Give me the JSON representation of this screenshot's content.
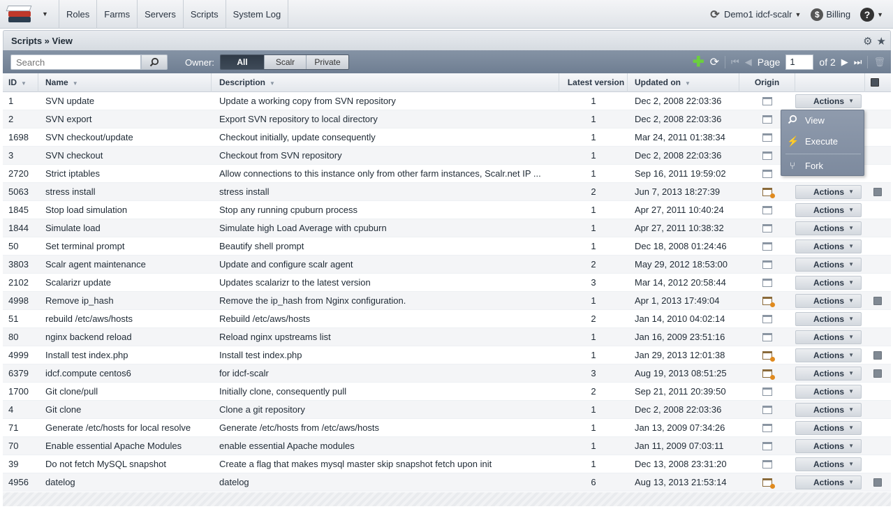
{
  "topbar": {
    "nav": [
      "Roles",
      "Farms",
      "Servers",
      "Scripts",
      "System Log"
    ],
    "environment": "Demo1 idcf-scalr",
    "billing": "Billing",
    "help": "?"
  },
  "panel": {
    "title": "Scripts » View"
  },
  "toolbar": {
    "search_placeholder": "Search",
    "owner_label": "Owner:",
    "owner_options": [
      "All",
      "Scalr",
      "Private"
    ],
    "owner_selected": "All",
    "page_label": "Page",
    "page_value": "1",
    "page_of": "of 2"
  },
  "grid": {
    "columns": {
      "id": "ID",
      "name": "Name",
      "description": "Description",
      "latest_version": "Latest version",
      "updated_on": "Updated on",
      "origin": "Origin"
    },
    "rows": [
      {
        "id": "1",
        "name": "SVN update",
        "description": "Update a working copy from SVN repository",
        "version": "1",
        "updated": "Dec 2, 2008 22:03:36",
        "origin": "shared",
        "action": "Actions",
        "checkbox": false
      },
      {
        "id": "2",
        "name": "SVN export",
        "description": "Export SVN repository to local directory",
        "version": "1",
        "updated": "Dec 2, 2008 22:03:36",
        "origin": "shared",
        "action": "",
        "checkbox": false
      },
      {
        "id": "1698",
        "name": "SVN checkout/update",
        "description": "Checkout initially, update consequently",
        "version": "1",
        "updated": "Mar 24, 2011 01:38:34",
        "origin": "shared",
        "action": "",
        "checkbox": false
      },
      {
        "id": "3",
        "name": "SVN checkout",
        "description": "Checkout from SVN repository",
        "version": "1",
        "updated": "Dec 2, 2008 22:03:36",
        "origin": "shared",
        "action": "",
        "checkbox": false
      },
      {
        "id": "2720",
        "name": "Strict iptables",
        "description": "Allow connections to this instance only from other farm instances, Scalr.net IP ...",
        "version": "1",
        "updated": "Sep 16, 2011 19:59:02",
        "origin": "shared",
        "action": "",
        "checkbox": false
      },
      {
        "id": "5063",
        "name": "stress install",
        "description": "stress install",
        "version": "2",
        "updated": "Jun 7, 2013 18:27:39",
        "origin": "custom",
        "action": "Actions",
        "checkbox": true
      },
      {
        "id": "1845",
        "name": "Stop load simulation",
        "description": "Stop any running cpuburn process",
        "version": "1",
        "updated": "Apr 27, 2011 10:40:24",
        "origin": "shared",
        "action": "Actions",
        "checkbox": false
      },
      {
        "id": "1844",
        "name": "Simulate load",
        "description": "Simulate high Load Average with cpuburn",
        "version": "1",
        "updated": "Apr 27, 2011 10:38:32",
        "origin": "shared",
        "action": "Actions",
        "checkbox": false
      },
      {
        "id": "50",
        "name": "Set terminal prompt",
        "description": "Beautify shell prompt",
        "version": "1",
        "updated": "Dec 18, 2008 01:24:46",
        "origin": "shared",
        "action": "Actions",
        "checkbox": false
      },
      {
        "id": "3803",
        "name": "Scalr agent maintenance",
        "description": "Update and configure scalr agent",
        "version": "2",
        "updated": "May 29, 2012 18:53:00",
        "origin": "shared",
        "action": "Actions",
        "checkbox": false
      },
      {
        "id": "2102",
        "name": "Scalarizr update",
        "description": "Updates scalarizr to the latest version",
        "version": "3",
        "updated": "Mar 14, 2012 20:58:44",
        "origin": "shared",
        "action": "Actions",
        "checkbox": false
      },
      {
        "id": "4998",
        "name": "Remove ip_hash",
        "description": "Remove the ip_hash from Nginx configuration.",
        "version": "1",
        "updated": "Apr 1, 2013 17:49:04",
        "origin": "custom",
        "action": "Actions",
        "checkbox": true
      },
      {
        "id": "51",
        "name": "rebuild /etc/aws/hosts",
        "description": "Rebuild /etc/aws/hosts",
        "version": "2",
        "updated": "Jan 14, 2010 04:02:14",
        "origin": "shared",
        "action": "Actions",
        "checkbox": false
      },
      {
        "id": "80",
        "name": "nginx backend reload",
        "description": "Reload nginx upstreams list",
        "version": "1",
        "updated": "Jan 16, 2009 23:51:16",
        "origin": "shared",
        "action": "Actions",
        "checkbox": false
      },
      {
        "id": "4999",
        "name": "Install test index.php",
        "description": "Install test index.php",
        "version": "1",
        "updated": "Jan 29, 2013 12:01:38",
        "origin": "custom",
        "action": "Actions",
        "checkbox": true
      },
      {
        "id": "6379",
        "name": "idcf.compute centos6",
        "description": "for idcf-scalr",
        "version": "3",
        "updated": "Aug 19, 2013 08:51:25",
        "origin": "custom",
        "action": "Actions",
        "checkbox": true
      },
      {
        "id": "1700",
        "name": "Git clone/pull",
        "description": "Initially clone, consequently pull",
        "version": "2",
        "updated": "Sep 21, 2011 20:39:50",
        "origin": "shared",
        "action": "Actions",
        "checkbox": false
      },
      {
        "id": "4",
        "name": "Git clone",
        "description": "Clone a git repository",
        "version": "1",
        "updated": "Dec 2, 2008 22:03:36",
        "origin": "shared",
        "action": "Actions",
        "checkbox": false
      },
      {
        "id": "71",
        "name": "Generate /etc/hosts for local resolve",
        "description": "Generate /etc/hosts from /etc/aws/hosts",
        "version": "1",
        "updated": "Jan 13, 2009 07:34:26",
        "origin": "shared",
        "action": "Actions",
        "checkbox": false
      },
      {
        "id": "70",
        "name": "Enable essential Apache Modules",
        "description": "enable essential Apache modules",
        "version": "1",
        "updated": "Jan 11, 2009 07:03:11",
        "origin": "shared",
        "action": "Actions",
        "checkbox": false
      },
      {
        "id": "39",
        "name": "Do not fetch MySQL snapshot",
        "description": "Create a flag that makes mysql master skip snapshot fetch upon init",
        "version": "1",
        "updated": "Dec 13, 2008 23:31:20",
        "origin": "shared",
        "action": "Actions",
        "checkbox": false
      },
      {
        "id": "4956",
        "name": "datelog",
        "description": "datelog",
        "version": "6",
        "updated": "Aug 13, 2013 21:53:14",
        "origin": "custom",
        "action": "Actions",
        "checkbox": true
      }
    ]
  },
  "actions_menu": {
    "items": [
      "View",
      "Execute",
      "Fork"
    ]
  }
}
